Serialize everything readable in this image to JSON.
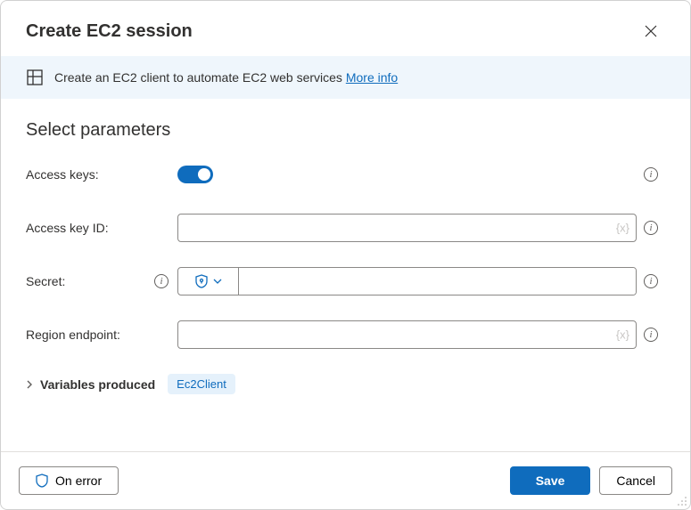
{
  "header": {
    "title": "Create EC2 session"
  },
  "banner": {
    "text": "Create an EC2 client to automate EC2 web services",
    "more_info": "More info"
  },
  "section": {
    "title": "Select parameters"
  },
  "params": {
    "access_keys": {
      "label": "Access keys:"
    },
    "access_key_id": {
      "label": "Access key ID:",
      "value": "",
      "hint": "{x}"
    },
    "secret": {
      "label": "Secret:",
      "value": ""
    },
    "region_endpoint": {
      "label": "Region endpoint:",
      "value": "",
      "hint": "{x}"
    }
  },
  "vars": {
    "label": "Variables produced",
    "chip": "Ec2Client"
  },
  "footer": {
    "on_error": "On error",
    "save": "Save",
    "cancel": "Cancel"
  }
}
